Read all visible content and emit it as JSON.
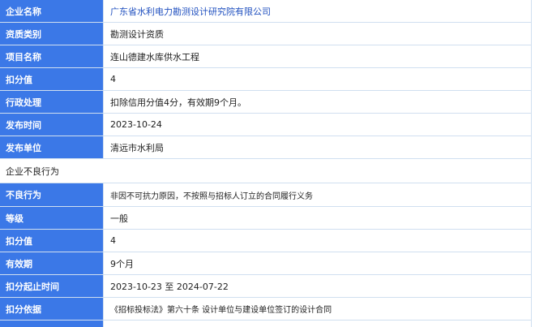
{
  "company": {
    "rows": [
      {
        "label": "企业名称",
        "value": "广东省水利电力勘测设计研究院有限公司"
      },
      {
        "label": "资质类别",
        "value": "勘测设计资质"
      },
      {
        "label": "项目名称",
        "value": "连山德建水库供水工程"
      },
      {
        "label": "扣分值",
        "value": "4"
      },
      {
        "label": "行政处理",
        "value": "扣除信用分值4分，有效期9个月。"
      },
      {
        "label": "发布时间",
        "value": "2023-10-24"
      },
      {
        "label": "发布单位",
        "value": "清远市水利局"
      }
    ]
  },
  "bad_behavior": {
    "section_title": "企业不良行为",
    "rows": [
      {
        "label": "不良行为",
        "value": "非因不可抗力原因，不按照与招标人订立的合同履行义务"
      },
      {
        "label": "等级",
        "value": "一般"
      },
      {
        "label": "扣分值",
        "value": "4"
      },
      {
        "label": "有效期",
        "value": "9个月"
      },
      {
        "label": "扣分起止时间",
        "value": "2023-10-23 至 2024-07-22"
      },
      {
        "label": "扣分依据",
        "value": "《招标投标法》第六十条 设计单位与建设单位签订的设计合同"
      }
    ]
  },
  "colors": {
    "label_bg": "#3b78e7",
    "border": "#d0dff0",
    "link": "#1f4fbf"
  }
}
